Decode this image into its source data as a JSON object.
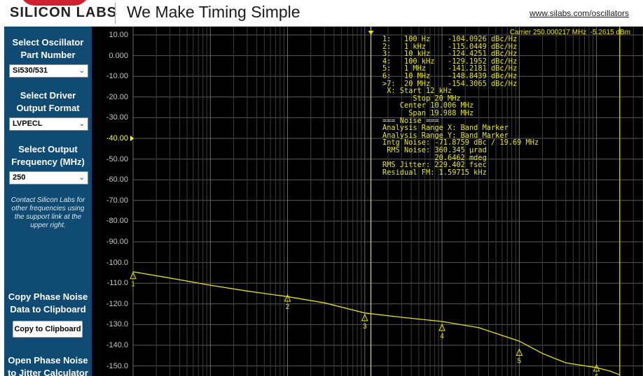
{
  "header": {
    "logo_text": "SILICON LABS",
    "tagline": "We Make Timing Simple",
    "site_link": "www.silabs.com/oscillators"
  },
  "sidebar": {
    "part_label": "Select Oscillator Part Number",
    "part_value": "Si530/531",
    "driver_label": "Select Driver Output Format",
    "driver_value": "LVPECL",
    "freq_label": "Select Output Frequency (MHz)",
    "freq_value": "250",
    "contact_note": "Contact Silicon Labs for other frequencies using the support link at the upper right.",
    "copy_title": "Copy Phase Noise Data to Clipboard",
    "copy_button": "Copy to Clipboard",
    "jitter_title": "Open Phase Noise to Jitter Calculator"
  },
  "chart_data": {
    "type": "line",
    "title": "",
    "xlabel": "",
    "ylabel": "",
    "x_scale": "log",
    "xlim": [
      10,
      40000000
    ],
    "ylim": [
      -150,
      10
    ],
    "yticks": [
      "10.00",
      "0.000",
      "-10.00",
      "-20.00",
      "-30.00",
      "-40.00",
      "-50.00",
      "-60.00",
      "-70.00",
      "-80.00",
      "-90.00",
      "-100.0",
      "-110.0",
      "-120.0",
      "-130.0",
      "-140.0",
      "-150.0"
    ],
    "reference_level": "-40.00",
    "grid": true,
    "series": [
      {
        "color": "#e6e600",
        "x": [
          10,
          30,
          100,
          300,
          1000,
          3000,
          10000,
          30000,
          100000,
          300000,
          1000000,
          2000000,
          4000000,
          10000000,
          15000000,
          20000000
        ],
        "y": [
          -104.5,
          -107.5,
          -111,
          -113.8,
          -116.5,
          -119.5,
          -124.4,
          -126.5,
          -128.5,
          -131.5,
          -138,
          -144,
          -148.5,
          -150.8,
          -152.5,
          -154.3
        ]
      }
    ],
    "markers": [
      {
        "label": "1",
        "x": 10,
        "y": -104.1
      },
      {
        "label": "2",
        "x": 1000,
        "y": -115.0
      },
      {
        "label": "3",
        "x": 10000,
        "y": -124.4
      },
      {
        "label": "4",
        "x": 100000,
        "y": -129.2
      },
      {
        "label": "5",
        "x": 1000000,
        "y": -141.2
      },
      {
        "label": "6",
        "x": 10000000,
        "y": -148.8
      },
      {
        "label": "7",
        "x": 20000000,
        "y": -154.3
      }
    ],
    "band_markers": [
      12000,
      20000000
    ],
    "carrier_line": "Carrier 250.000217 MHz  -5.2615 dBm",
    "readout": [
      "1:   100 Hz    -104.0926 dBc/Hz",
      "2:   1 kHz     -115.0449 dBc/Hz",
      "3:   10 kHz    -124.4251 dBc/Hz",
      "4:   100 kHz   -129.1952 dBc/Hz",
      "5:   1 MHz     -141.2181 dBc/Hz",
      "6:   10 MHz    -148.8439 dBc/Hz",
      ">7:  20 MHz    -154.3065 dBc/Hz",
      " X: Start 12 kHz",
      "       Stop 20 MHz",
      "    Center 10.006 MHz",
      "      Span 19.988 MHz",
      "=== Noise ===",
      "Analysis Range X: Band Marker",
      "Analysis Range Y: Band Marker",
      "Intg Noise: -71.8759 dBc / 19.69 MHz",
      " RMS Noise: 360.345 µrad",
      "            20.6462 mdeg",
      "RMS Jitter: 229.402 fsec",
      "Residual FM: 1.59715 kHz"
    ]
  }
}
